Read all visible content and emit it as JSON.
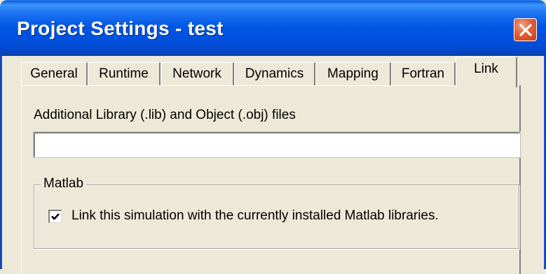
{
  "window": {
    "title": "Project Settings - test"
  },
  "tabs": [
    {
      "label": "General"
    },
    {
      "label": "Runtime"
    },
    {
      "label": "Network"
    },
    {
      "label": "Dynamics"
    },
    {
      "label": "Mapping"
    },
    {
      "label": "Fortran"
    },
    {
      "label": "Link"
    }
  ],
  "active_tab": "Link",
  "link_page": {
    "files_label": "Additional Library (.lib) and Object (.obj) files",
    "files_value": "",
    "matlab_group": {
      "title": "Matlab",
      "checkbox_label": "Link this simulation with the currently installed Matlab libraries.",
      "checked": true
    }
  },
  "icons": {
    "close": "close-icon",
    "check": "checkmark-icon"
  },
  "colors": {
    "titlebar": "#0055e5",
    "close_button": "#e45d36",
    "dialog_face": "#ece9d8"
  }
}
